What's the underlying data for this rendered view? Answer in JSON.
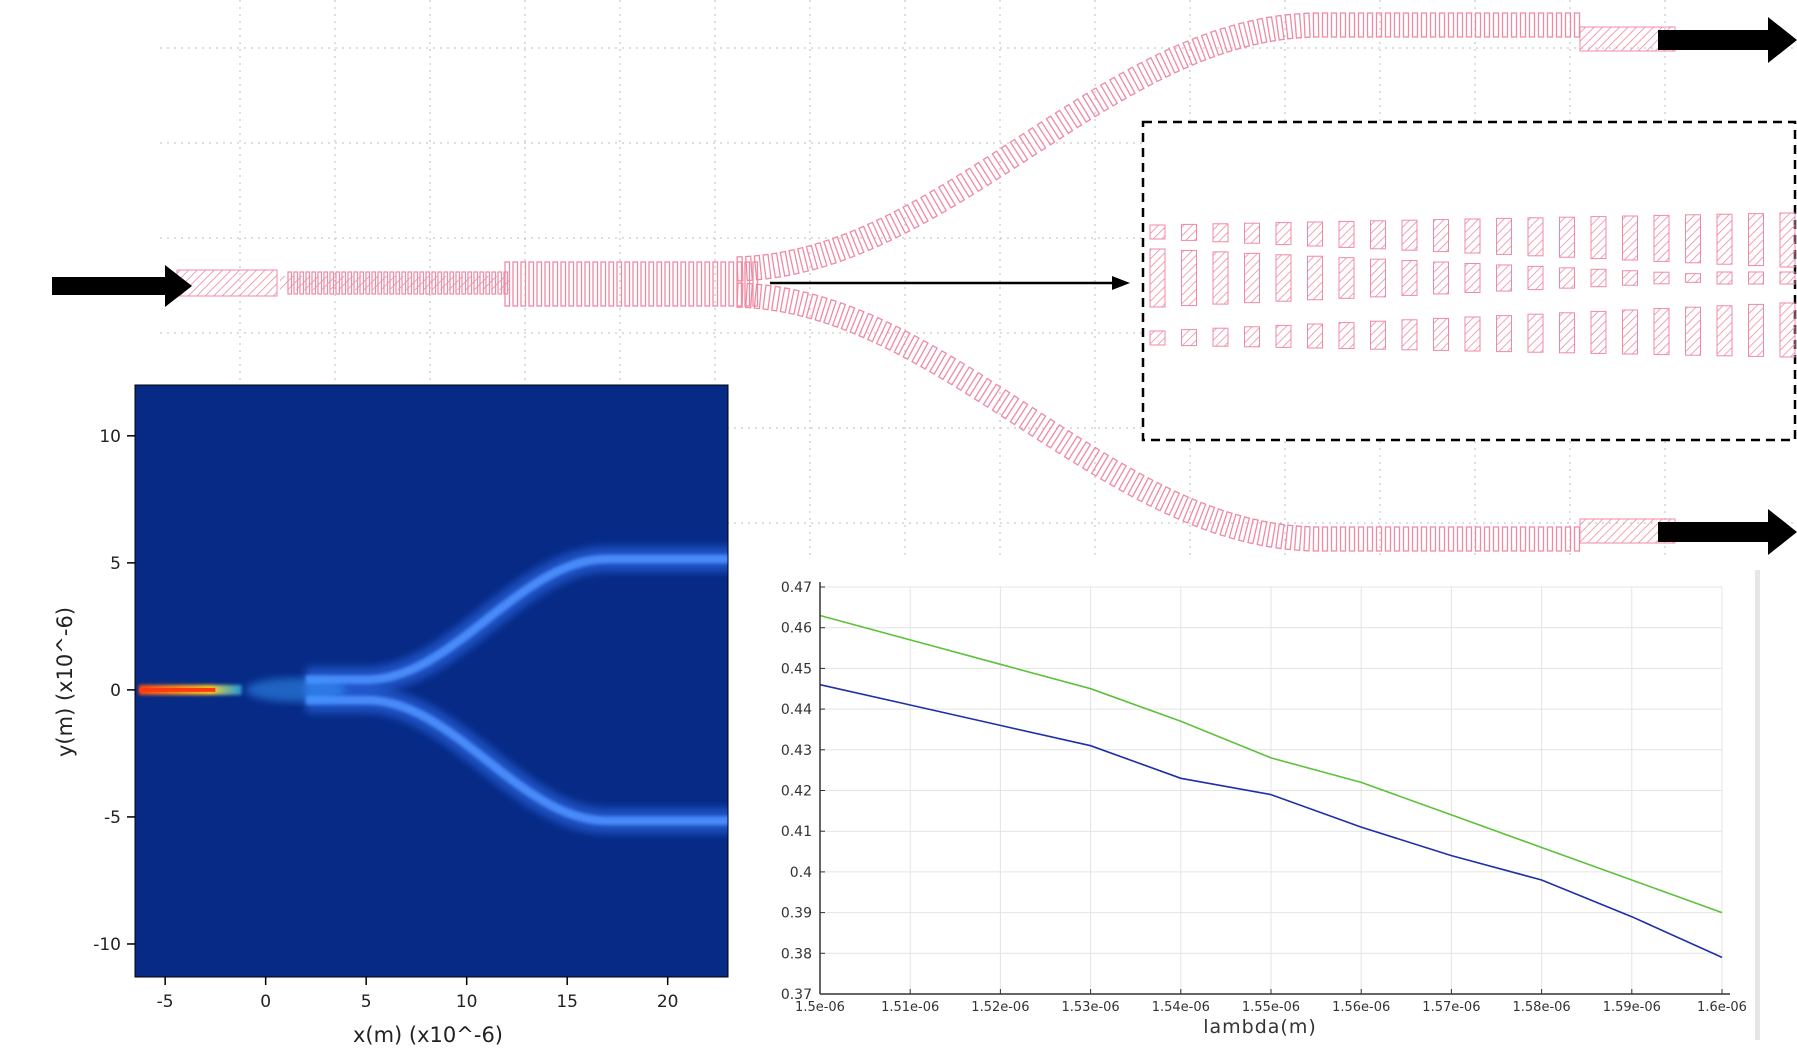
{
  "field_plot": {
    "xlabel": "x(m) (x10^-6)",
    "ylabel": "y(m) (x10^-6)",
    "x_ticks": [
      "-5",
      "0",
      "5",
      "10",
      "15",
      "20"
    ],
    "y_ticks": [
      "10",
      "5",
      "0",
      "-5",
      "-10"
    ],
    "xlim": [
      -6.5,
      23
    ],
    "ylim": [
      -11.3,
      12
    ],
    "colors": {
      "background": "#062a86",
      "mode": "#3a78ff",
      "hot": "#ff3a10"
    }
  },
  "chart_data": {
    "type": "line",
    "x": [
      1.5e-06,
      1.51e-06,
      1.52e-06,
      1.53e-06,
      1.54e-06,
      1.55e-06,
      1.56e-06,
      1.57e-06,
      1.58e-06,
      1.59e-06,
      1.6e-06
    ],
    "x_tick_labels": [
      "1.5e-06",
      "1.51e-06",
      "1.52e-06",
      "1.53e-06",
      "1.54e-06",
      "1.55e-06",
      "1.56e-06",
      "1.57e-06",
      "1.58e-06",
      "1.59e-06",
      "1.6e-06"
    ],
    "y_tick_labels": [
      "0.47",
      "0.46",
      "0.45",
      "0.44",
      "0.43",
      "0.42",
      "0.41",
      "0.4",
      "0.39",
      "0.38",
      "0.37"
    ],
    "series": [
      {
        "color": "#5cc23a",
        "values": [
          0.463,
          0.457,
          0.451,
          0.445,
          0.437,
          0.428,
          0.422,
          0.414,
          0.406,
          0.398,
          0.39
        ]
      },
      {
        "color": "#1f2fa8",
        "values": [
          0.446,
          0.441,
          0.436,
          0.431,
          0.423,
          0.419,
          0.411,
          0.404,
          0.398,
          0.389,
          0.379
        ]
      }
    ],
    "xlabel": "lambda(m)",
    "ylabel": "",
    "xlim": [
      1.5e-06,
      1.6e-06
    ],
    "ylim": [
      0.37,
      0.47
    ],
    "grid": true
  },
  "colors": {
    "waveguide": "#f08aa4",
    "arrow": "#000000"
  }
}
